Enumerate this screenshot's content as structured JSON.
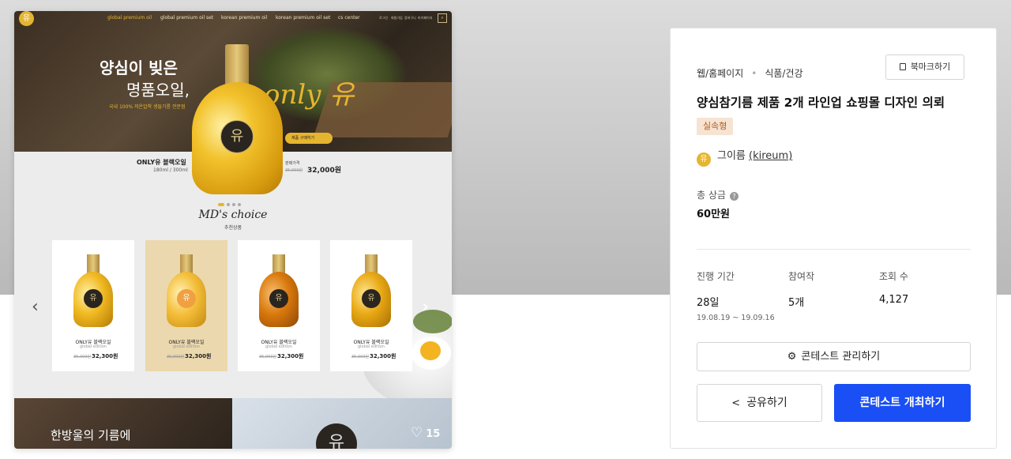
{
  "preview": {
    "nav": {
      "links": [
        "global premium oil",
        "global premium oil set",
        "korean premium oil",
        "korean premium oil set",
        "cs center"
      ],
      "small_links": [
        "로그인",
        "회원가입",
        "장바구니",
        "마이페이지"
      ],
      "logo_glyph": "유"
    },
    "hero": {
      "title_line1": "양심이 빚은",
      "title_line2": "명품오일,",
      "subtitle": "국내 100% 저온압착 생들기름 전문점",
      "script_text": "only 유",
      "cta_label": "제품 구매하기",
      "bottle_glyph": "유",
      "product_name": "ONLY유 블랙오일",
      "product_volume": "180ml / 300ml",
      "price_label": "판매가격",
      "price_old": "35,000원",
      "price": "32,000원"
    },
    "md": {
      "title": "MD's choice",
      "subtitle": "추천상품"
    },
    "products": [
      {
        "name": "ONLY유 블랙오일",
        "edition": "global edition",
        "old_price": "35,000원",
        "price": "32,300원",
        "glyph": "유",
        "color": "#f0b820"
      },
      {
        "name": "ONLY유 블랙오일",
        "edition": "global edition",
        "old_price": "35,000원",
        "price": "32,300원",
        "glyph": "유",
        "color": "#f4be3a"
      },
      {
        "name": "ONLY유 블랙오일",
        "edition": "global edition",
        "old_price": "35,000원",
        "price": "32,300원",
        "glyph": "유",
        "color": "#d8780c"
      },
      {
        "name": "ONLY유 블랙오일",
        "edition": "global edition",
        "old_price": "35,000원",
        "price": "32,300원",
        "glyph": "유",
        "color": "#e8a814"
      }
    ],
    "arrows": {
      "prev": "‹",
      "next": "›"
    },
    "banner": {
      "text": "한방울의 기름에",
      "circle_glyph": "유"
    },
    "likes": {
      "icon": "heart-outline-icon",
      "count": "15"
    }
  },
  "contest": {
    "category": "웹/홈페이지",
    "subcategory": "식품/건강",
    "bookmark_label": "북마크하기",
    "title": "양심참기름 제품 2개 라인업 쇼핑몰 디자인 의뢰",
    "tag": "실속형",
    "author_name": "그이름",
    "author_handle": "(kireum)",
    "prize_label": "총 상금",
    "prize_value": "60만원",
    "stats": {
      "period_label": "진행 기간",
      "period_value": "28일",
      "period_dates": "19.08.19 ~ 19.09.16",
      "entries_label": "참여작",
      "entries_value": "5개",
      "views_label": "조회 수",
      "views_value": "4,127"
    },
    "manage_label": "콘테스트 관리하기",
    "share_label": "공유하기",
    "host_label": "콘테스트 개최하기"
  },
  "colors": {
    "accent_blue": "#1a4ff5",
    "brand_gold": "#e6b530",
    "tag_bg": "#f7e3d2",
    "tag_text": "#b05a22"
  }
}
